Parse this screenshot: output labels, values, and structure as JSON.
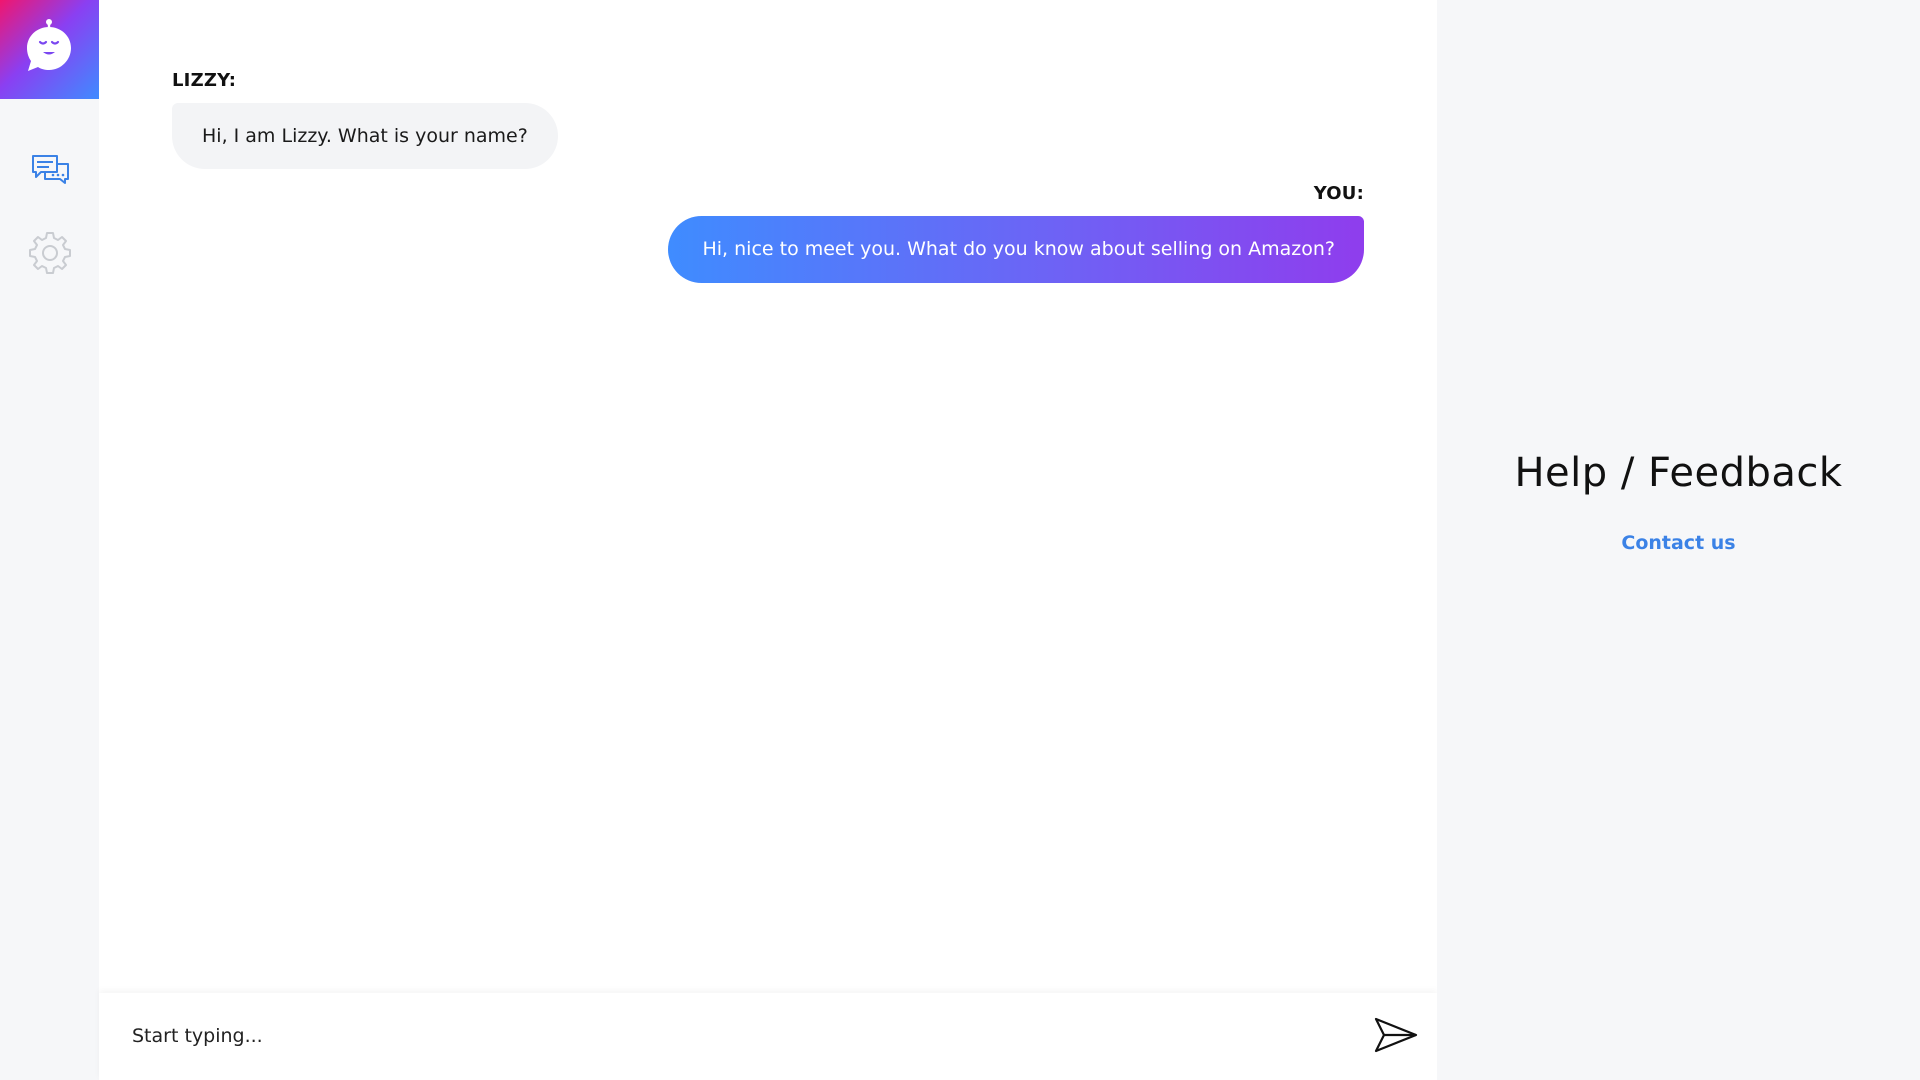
{
  "sidebar": {
    "logo_icon": "chatbot-face-icon",
    "items": [
      {
        "id": "chat",
        "icon": "chat-bubbles-icon"
      },
      {
        "id": "settings",
        "icon": "gear-icon"
      }
    ]
  },
  "chat": {
    "messages": [
      {
        "sender": "LIZZY:",
        "text": "Hi, I am Lizzy. What is your name?"
      },
      {
        "sender": "YOU:",
        "text": "Hi, nice to meet you. What do you know about selling on Amazon?"
      }
    ]
  },
  "input": {
    "placeholder": "Start typing...",
    "send_icon": "send-arrow-icon"
  },
  "help": {
    "title": "Help / Feedback",
    "contact_label": "Contact us"
  },
  "colors": {
    "logo_gradient": [
      "#f0166e",
      "#8a3ff2",
      "#3f8bff"
    ],
    "user_bubble_gradient": [
      "#3f8cff",
      "#6d63f5",
      "#8f3ded"
    ],
    "bot_bubble": "#f3f4f6",
    "link": "#3b82e6",
    "panel_bg": "#f6f7f9",
    "nav_icon_active": "#3b82e6",
    "nav_icon_inactive": "#c9ccd1"
  }
}
